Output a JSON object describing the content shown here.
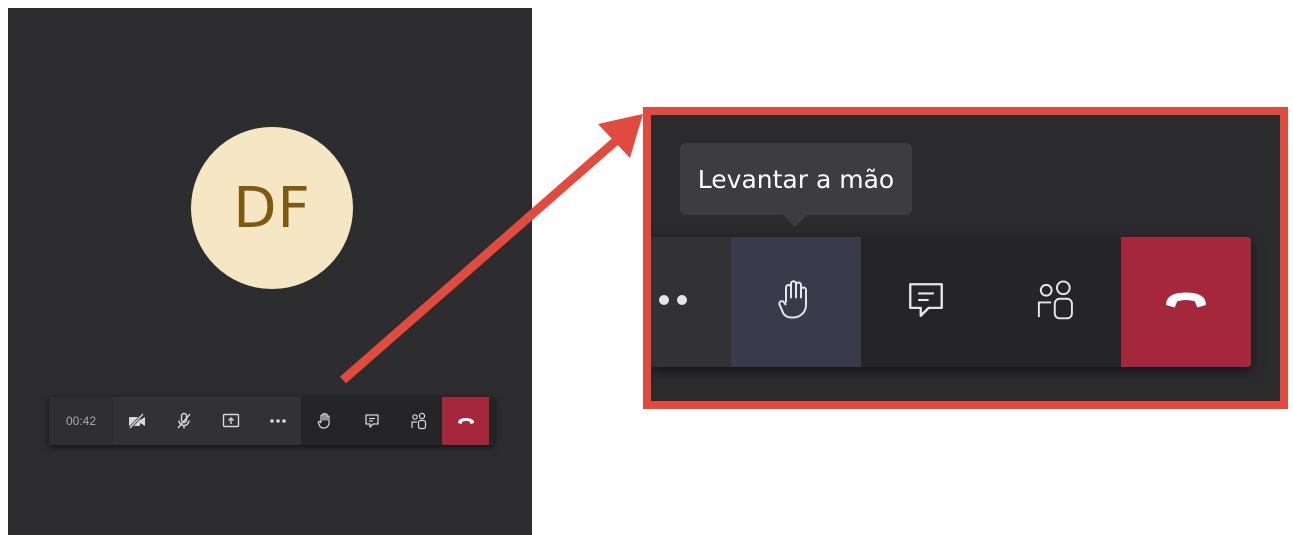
{
  "meeting": {
    "avatar_initials": "DF",
    "timer": "00:42"
  },
  "toolbar": {
    "buttons": [
      {
        "name": "camera-off-button",
        "icon": "video-off-icon"
      },
      {
        "name": "mic-off-button",
        "icon": "mic-off-icon"
      },
      {
        "name": "share-button",
        "icon": "share-screen-icon"
      },
      {
        "name": "more-button",
        "icon": "more-icon"
      },
      {
        "name": "raise-hand-button",
        "icon": "hand-icon"
      },
      {
        "name": "chat-button",
        "icon": "chat-icon"
      },
      {
        "name": "participants-button",
        "icon": "people-icon"
      },
      {
        "name": "hang-up-button",
        "icon": "phone-hangup-icon"
      }
    ]
  },
  "zoom": {
    "tooltip": "Levantar a mão"
  },
  "colors": {
    "panel_bg": "#2d2c2e",
    "avatar_bg": "#f5e6c4",
    "avatar_text": "#7d5a10",
    "hangup": "#a4273b",
    "highlight_frame": "#e04a3f",
    "raise_hand_active": "#3b3a4a"
  }
}
